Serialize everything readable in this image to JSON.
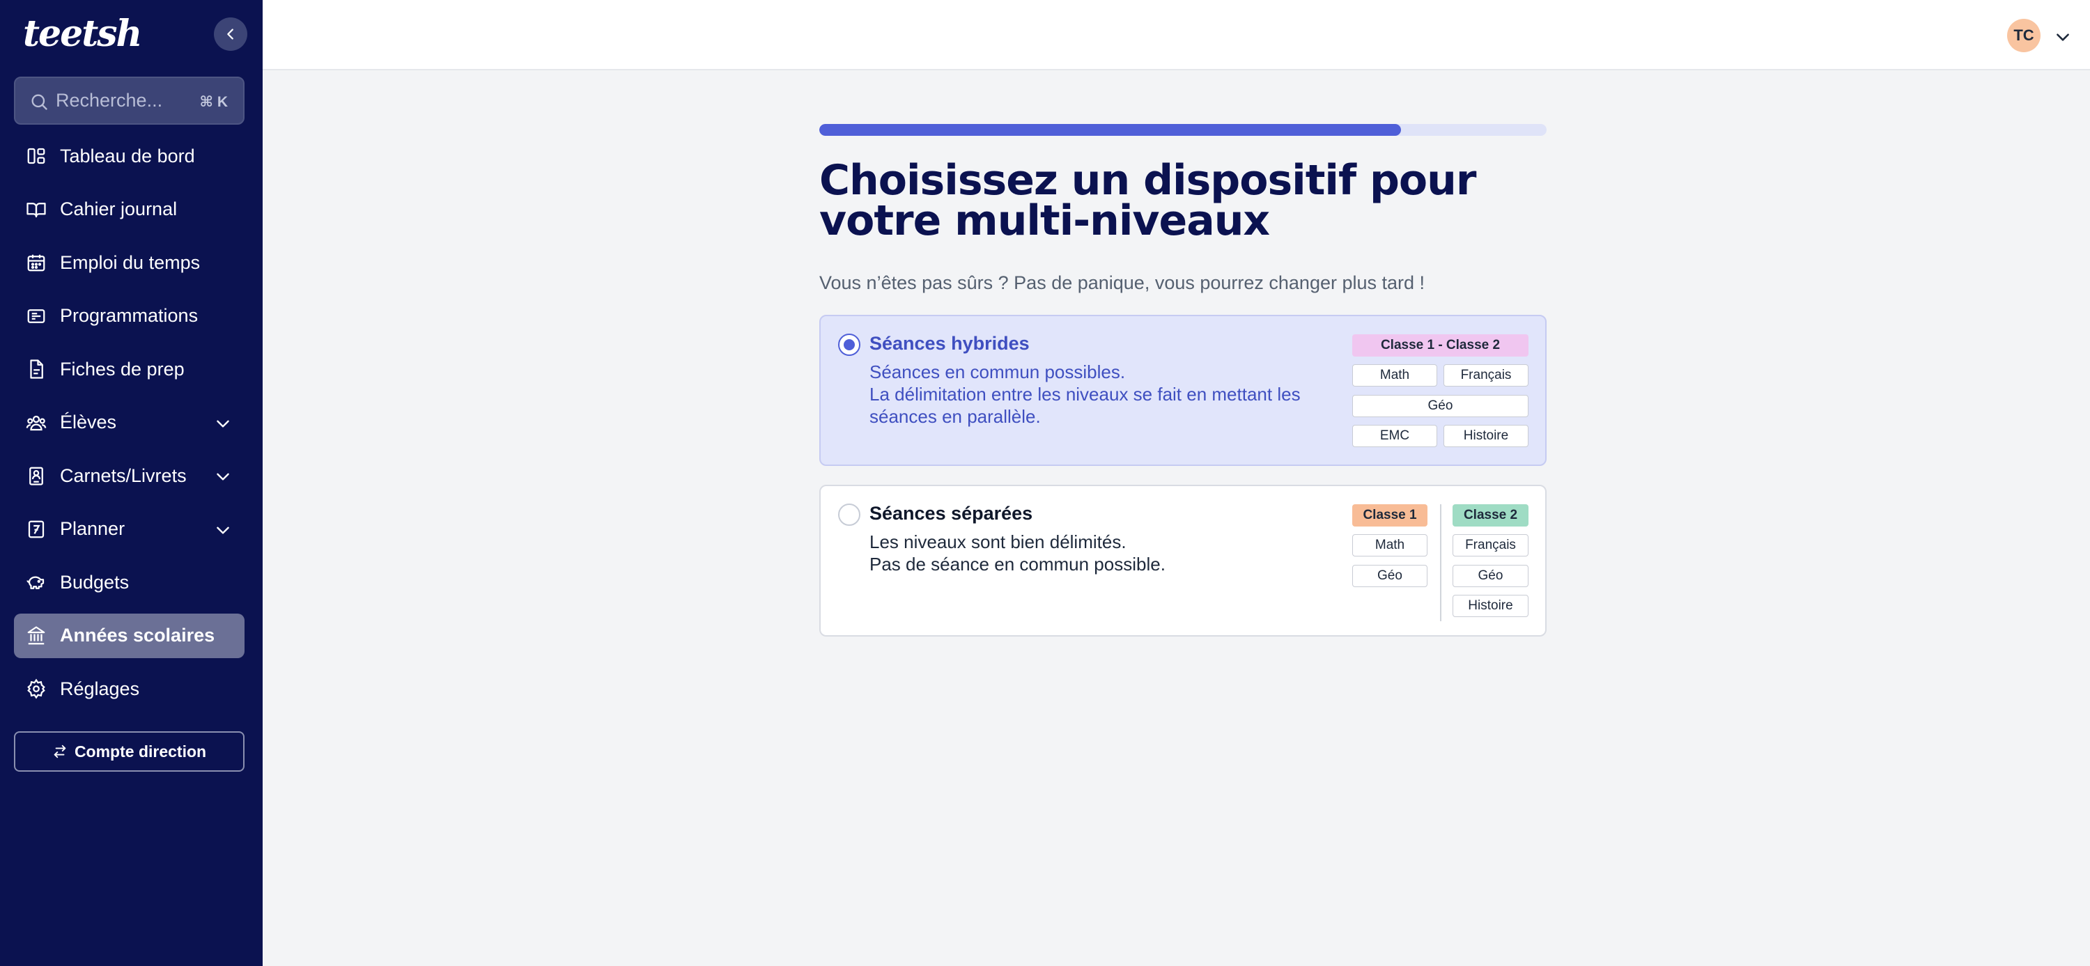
{
  "app": {
    "logo_text": "teetsh"
  },
  "sidebar": {
    "search": {
      "placeholder": "Recherche...",
      "shortcut": "⌘ K"
    },
    "items": [
      {
        "label": "Tableau de bord",
        "icon": "dashboard-icon"
      },
      {
        "label": "Cahier journal",
        "icon": "book-open-icon"
      },
      {
        "label": "Emploi du temps",
        "icon": "calendar-icon"
      },
      {
        "label": "Programmations",
        "icon": "list-card-icon"
      },
      {
        "label": "Fiches de prep",
        "icon": "file-icon"
      },
      {
        "label": "Élèves",
        "icon": "users-icon",
        "expandable": true
      },
      {
        "label": "Carnets/Livrets",
        "icon": "notebook-icon",
        "expandable": true
      },
      {
        "label": "Planner",
        "icon": "planner-icon",
        "expandable": true
      },
      {
        "label": "Budgets",
        "icon": "piggy-bank-icon"
      },
      {
        "label": "Années scolaires",
        "icon": "school-building-icon",
        "active": true
      },
      {
        "label": "Réglages",
        "icon": "gear-icon"
      }
    ],
    "direction_button": "Compte direction"
  },
  "topbar": {
    "avatar_initials": "TC"
  },
  "main": {
    "progress": 0.8,
    "title": "Choisissez un dispositif pour votre multi-niveaux",
    "subtitle": "Vous n’êtes pas sûrs ? Pas de panique, vous pourrez changer plus tard !",
    "options": [
      {
        "title": "Séances hybrides",
        "desc_lines": [
          "Séances en commun possibles.",
          "La délimitation entre les niveaux se fait en mettant les séances en parallèle."
        ],
        "selected": true,
        "illustration": {
          "header": "Classe 1 - Classe 2",
          "chips": [
            "Math",
            "Français",
            "Géo",
            "EMC",
            "Histoire"
          ]
        }
      },
      {
        "title": "Séances séparées",
        "desc_lines": [
          "Les niveaux sont bien délimités.",
          "Pas de séance en commun possible."
        ],
        "selected": false,
        "illustration": {
          "class1": {
            "header": "Classe 1",
            "chips": [
              "Math",
              "Géo"
            ]
          },
          "class2": {
            "header": "Classe 2",
            "chips": [
              "Français",
              "Géo",
              "Histoire"
            ]
          }
        }
      }
    ]
  },
  "colors": {
    "sidebar_bg": "#0b1250",
    "accent": "#4f5fd8",
    "hybrid_header": "#f0c6f0",
    "class1_header": "#f8bc96",
    "class2_header": "#9fdcc4"
  }
}
